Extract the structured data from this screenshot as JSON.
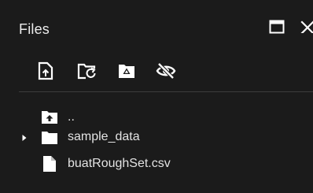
{
  "panel": {
    "title": "Files"
  },
  "window_controls": {
    "expand_icon": "expand-window-icon",
    "close_icon": "close-icon",
    "close_label": "×"
  },
  "toolbar": {
    "tools": [
      {
        "icon": "upload-file-icon"
      },
      {
        "icon": "refresh-folder-icon"
      },
      {
        "icon": "mount-drive-icon"
      },
      {
        "icon": "hide-icon"
      }
    ]
  },
  "tree": {
    "parent": {
      "label": "..",
      "icon": "folder-up-icon"
    },
    "items": [
      {
        "label": "sample_data",
        "icon": "folder-icon",
        "expandable": true
      },
      {
        "label": "buatRoughSet.csv",
        "icon": "file-icon",
        "expandable": false
      }
    ]
  },
  "colors": {
    "background": "#1b1b1b",
    "text": "#e3e3e3",
    "icon": "#ffffff",
    "divider": "#3c3c3c"
  }
}
